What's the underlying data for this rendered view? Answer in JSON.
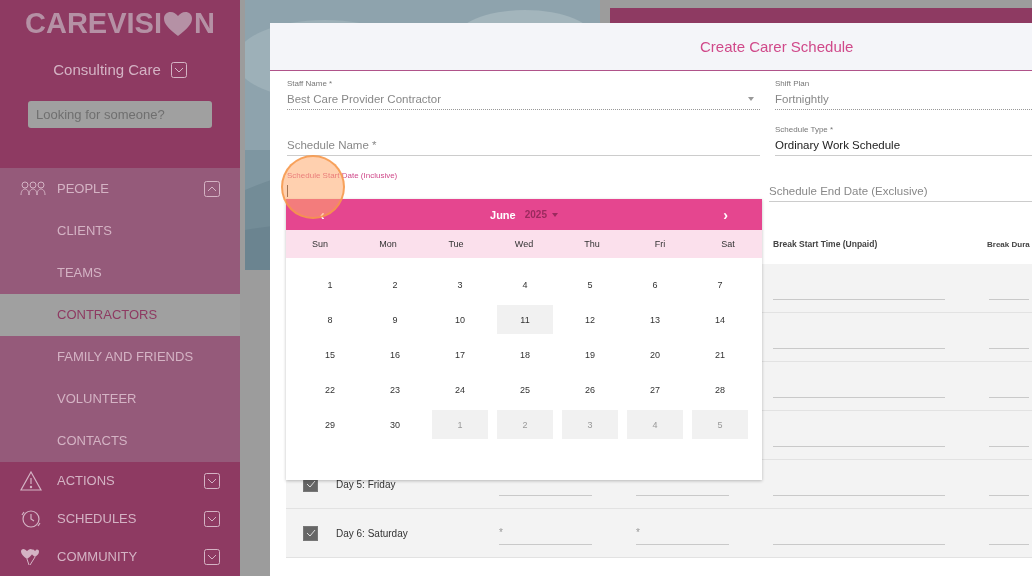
{
  "sidebar": {
    "logo": {
      "text_before": "CAREVISI",
      "text_after": "N"
    },
    "organization": "Consulting Care",
    "search": {
      "placeholder": "Looking for someone?"
    },
    "nav": [
      {
        "label": "PEOPLE",
        "expanded": true,
        "children": [
          {
            "label": "CLIENTS",
            "selected": false
          },
          {
            "label": "TEAMS",
            "selected": false
          },
          {
            "label": "CONTRACTORS",
            "selected": true
          },
          {
            "label": "FAMILY AND FRIENDS",
            "selected": false
          },
          {
            "label": "VOLUNTEER",
            "selected": false
          },
          {
            "label": "CONTACTS",
            "selected": false
          }
        ]
      },
      {
        "label": "ACTIONS",
        "expanded": false
      },
      {
        "label": "SCHEDULES",
        "expanded": false
      },
      {
        "label": "COMMUNITY",
        "expanded": false
      }
    ]
  },
  "dialog": {
    "title": "Create Carer Schedule",
    "fields": [
      {
        "kind": "select",
        "label": "Staff Name *",
        "value": "Best Care Provider Contractor",
        "disabled": true
      },
      {
        "kind": "text",
        "label": "Shift Plan",
        "value": "Fortnightly",
        "disabled": true
      },
      {
        "kind": "text",
        "placeholder": "Schedule Name *",
        "disabled": false
      },
      {
        "kind": "text",
        "label": "Schedule Type *",
        "value": "Ordinary Work Schedule",
        "disabled": false
      },
      {
        "kind": "date",
        "label": "Schedule Start Date (Inclusive)",
        "focused": true
      },
      {
        "kind": "date",
        "placeholder": "Schedule End Date (Exclusive)",
        "focused": false
      }
    ],
    "table": {
      "columns": [
        "Break Start Time (Unpaid)",
        "Break Dura"
      ],
      "rows": [
        {
          "kind": "covered"
        },
        {
          "kind": "covered"
        },
        {
          "kind": "covered"
        },
        {
          "kind": "covered"
        },
        {
          "kind": "day",
          "checked": true,
          "day": "Day 5: Friday"
        },
        {
          "kind": "day",
          "checked": true,
          "day": "Day 6: Saturday",
          "start_placeholder": "*",
          "end_placeholder": "*"
        }
      ]
    }
  },
  "date_picker": {
    "prev": "‹",
    "next": "›",
    "month": "June",
    "year": "2025",
    "weekdays": [
      "Sun",
      "Mon",
      "Tue",
      "Wed",
      "Thu",
      "Fri",
      "Sat"
    ],
    "days": [
      {
        "label": "1",
        "today": false,
        "other_month": false
      },
      {
        "label": "2",
        "today": false,
        "other_month": false
      },
      {
        "label": "3",
        "today": false,
        "other_month": false
      },
      {
        "label": "4",
        "today": false,
        "other_month": false
      },
      {
        "label": "5",
        "today": false,
        "other_month": false
      },
      {
        "label": "6",
        "today": false,
        "other_month": false
      },
      {
        "label": "7",
        "today": false,
        "other_month": false
      },
      {
        "label": "8",
        "today": false,
        "other_month": false
      },
      {
        "label": "9",
        "today": false,
        "other_month": false
      },
      {
        "label": "10",
        "today": false,
        "other_month": false
      },
      {
        "label": "11",
        "today": true,
        "other_month": false
      },
      {
        "label": "12",
        "today": false,
        "other_month": false
      },
      {
        "label": "13",
        "today": false,
        "other_month": false
      },
      {
        "label": "14",
        "today": false,
        "other_month": false
      },
      {
        "label": "15",
        "today": false,
        "other_month": false
      },
      {
        "label": "16",
        "today": false,
        "other_month": false
      },
      {
        "label": "17",
        "today": false,
        "other_month": false
      },
      {
        "label": "18",
        "today": false,
        "other_month": false
      },
      {
        "label": "19",
        "today": false,
        "other_month": false
      },
      {
        "label": "20",
        "today": false,
        "other_month": false
      },
      {
        "label": "21",
        "today": false,
        "other_month": false
      },
      {
        "label": "22",
        "today": false,
        "other_month": false
      },
      {
        "label": "23",
        "today": false,
        "other_month": false
      },
      {
        "label": "24",
        "today": false,
        "other_month": false
      },
      {
        "label": "25",
        "today": false,
        "other_month": false
      },
      {
        "label": "26",
        "today": false,
        "other_month": false
      },
      {
        "label": "27",
        "today": false,
        "other_month": false
      },
      {
        "label": "28",
        "today": false,
        "other_month": false
      },
      {
        "label": "29",
        "today": false,
        "other_month": false
      },
      {
        "label": "30",
        "today": false,
        "other_month": false
      },
      {
        "label": "1",
        "today": false,
        "other_month": true
      },
      {
        "label": "2",
        "today": false,
        "other_month": true
      },
      {
        "label": "3",
        "today": false,
        "other_month": true
      },
      {
        "label": "4",
        "today": false,
        "other_month": true
      },
      {
        "label": "5",
        "today": false,
        "other_month": true
      }
    ]
  }
}
